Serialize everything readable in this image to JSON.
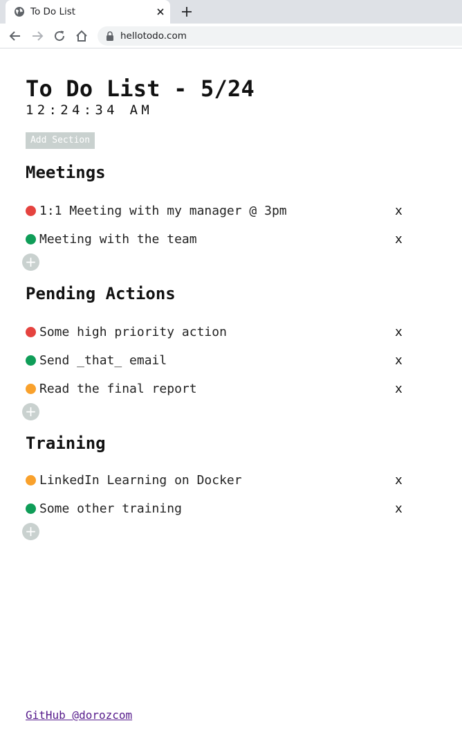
{
  "browser": {
    "tab_title": "To Do List",
    "url": "hellotodo.com"
  },
  "header": {
    "title": "To Do List - 5/24",
    "clock": "12:24:34 AM",
    "add_section_label": "Add Section"
  },
  "colors": {
    "red": "#e5433f",
    "green": "#0f9d58",
    "orange": "#f9a12c",
    "button_gray": "#c9d1cf"
  },
  "sections": [
    {
      "title": "Meetings",
      "items": [
        {
          "text": "1:1 Meeting with my manager @ 3pm",
          "priority": "red",
          "remove": "x"
        },
        {
          "text": "Meeting with the team",
          "priority": "green",
          "remove": "x"
        }
      ],
      "add_label": "+"
    },
    {
      "title": "Pending Actions",
      "items": [
        {
          "text": "Some high priority action",
          "priority": "red",
          "remove": "x"
        },
        {
          "text": "Send _that_ email",
          "priority": "green",
          "remove": "x"
        },
        {
          "text": "Read the final report",
          "priority": "orange",
          "remove": "x"
        }
      ],
      "add_label": "+"
    },
    {
      "title": "Training",
      "items": [
        {
          "text": "LinkedIn Learning on Docker",
          "priority": "orange",
          "remove": "x"
        },
        {
          "text": "Some other training",
          "priority": "green",
          "remove": "x"
        }
      ],
      "add_label": "+"
    }
  ],
  "footer": {
    "link_text": "GitHub @dorozcom"
  }
}
